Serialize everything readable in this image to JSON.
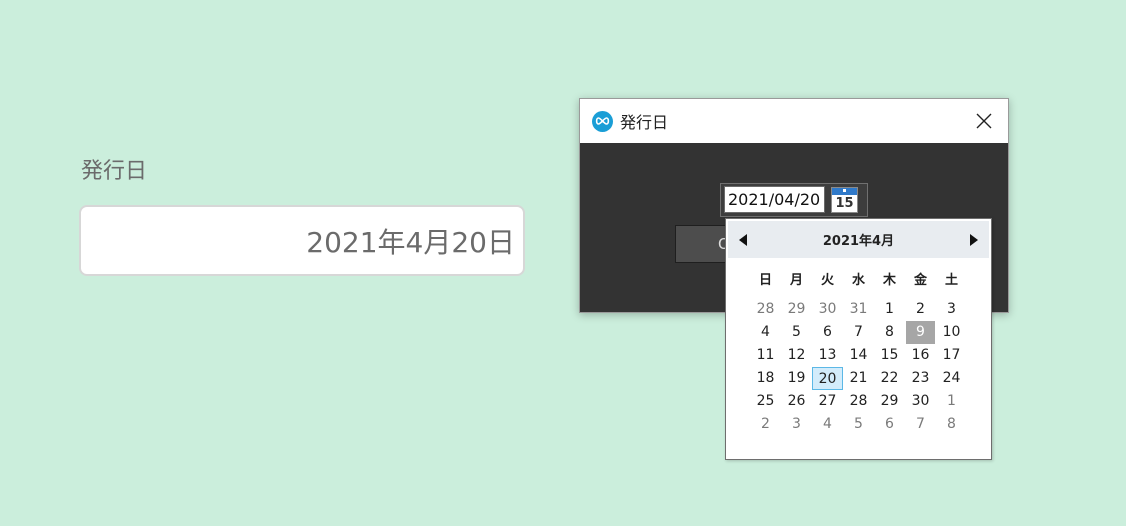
{
  "form": {
    "label": "発行日",
    "value": "2021年4月20日"
  },
  "dialog": {
    "title": "発行日",
    "date_value": "2021/04/20",
    "calendar_icon_day": "15",
    "button_label": "O"
  },
  "calendar": {
    "month_title": "2021年4月",
    "weekdays": [
      "日",
      "月",
      "火",
      "水",
      "木",
      "金",
      "土"
    ],
    "weeks": [
      [
        "28",
        "29",
        "30",
        "31",
        "1",
        "2",
        "3"
      ],
      [
        "4",
        "5",
        "6",
        "7",
        "8",
        "9",
        "10"
      ],
      [
        "11",
        "12",
        "13",
        "14",
        "15",
        "16",
        "17"
      ],
      [
        "18",
        "19",
        "20",
        "21",
        "22",
        "23",
        "24"
      ],
      [
        "25",
        "26",
        "27",
        "28",
        "29",
        "30",
        "1"
      ],
      [
        "2",
        "3",
        "4",
        "5",
        "6",
        "7",
        "8"
      ]
    ],
    "today": "9",
    "selected": "20"
  },
  "colors": {
    "page_bg": "#cbeedc",
    "dialog_bg": "#333333",
    "accent": "#1a9ed6",
    "selected_bg": "#d3ecfb",
    "today_bg": "#a6a6a6"
  }
}
